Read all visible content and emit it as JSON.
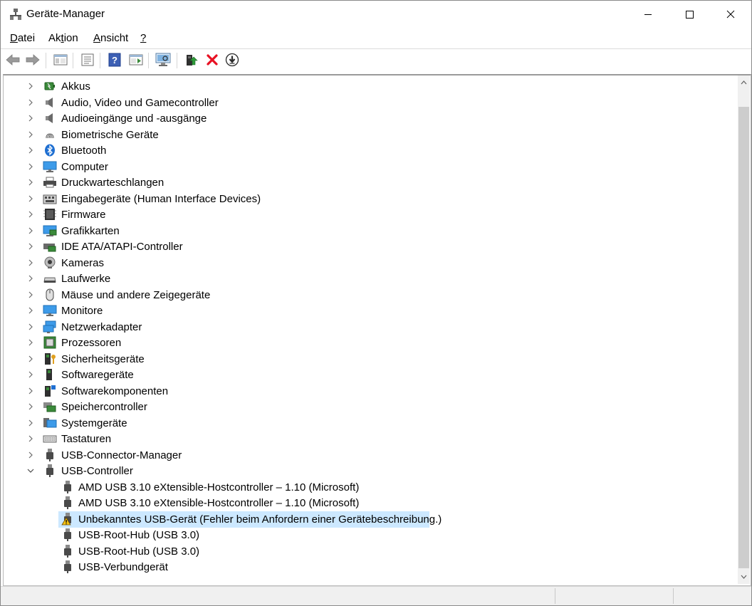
{
  "window": {
    "title": "Geräte-Manager"
  },
  "menu": [
    "Datei",
    "Aktion",
    "Ansicht",
    "?"
  ],
  "toolbar": {
    "buttons": [
      "back-icon",
      "forward-icon",
      "console-tree-icon",
      "properties-icon",
      "help-icon",
      "action-pane-icon",
      "scan-hardware-icon",
      "update-driver-icon",
      "uninstall-icon",
      "disable-device-icon"
    ]
  },
  "tree": {
    "categories": [
      {
        "label": "Akkus",
        "icon": "battery-icon"
      },
      {
        "label": "Audio, Video und Gamecontroller",
        "icon": "speaker-icon"
      },
      {
        "label": "Audioeingänge und -ausgänge",
        "icon": "speaker-icon"
      },
      {
        "label": "Biometrische Geräte",
        "icon": "fingerprint-icon"
      },
      {
        "label": "Bluetooth",
        "icon": "bluetooth-icon"
      },
      {
        "label": "Computer",
        "icon": "computer-icon"
      },
      {
        "label": "Druckwarteschlangen",
        "icon": "printer-icon"
      },
      {
        "label": "Eingabegeräte (Human Interface Devices)",
        "icon": "hid-icon"
      },
      {
        "label": "Firmware",
        "icon": "firmware-icon"
      },
      {
        "label": "Grafikkarten",
        "icon": "display-adapter-icon"
      },
      {
        "label": "IDE ATA/ATAPI-Controller",
        "icon": "ide-controller-icon"
      },
      {
        "label": "Kameras",
        "icon": "camera-icon"
      },
      {
        "label": "Laufwerke",
        "icon": "drive-icon"
      },
      {
        "label": "Mäuse und andere Zeigegeräte",
        "icon": "mouse-icon"
      },
      {
        "label": "Monitore",
        "icon": "monitor-icon"
      },
      {
        "label": "Netzwerkadapter",
        "icon": "network-adapter-icon"
      },
      {
        "label": "Prozessoren",
        "icon": "processor-icon"
      },
      {
        "label": "Sicherheitsgeräte",
        "icon": "security-device-icon"
      },
      {
        "label": "Softwaregeräte",
        "icon": "software-device-icon"
      },
      {
        "label": "Softwarekomponenten",
        "icon": "software-component-icon"
      },
      {
        "label": "Speichercontroller",
        "icon": "storage-controller-icon"
      },
      {
        "label": "Systemgeräte",
        "icon": "system-device-icon"
      },
      {
        "label": "Tastaturen",
        "icon": "keyboard-icon"
      },
      {
        "label": "USB-Connector-Manager",
        "icon": "usb-icon"
      },
      {
        "label": "USB-Controller",
        "icon": "usb-icon",
        "expanded": true
      }
    ],
    "usb_children": [
      {
        "label": "AMD USB 3.10 eXtensible-Hostcontroller – 1.10 (Microsoft)",
        "icon": "usb-icon"
      },
      {
        "label": "AMD USB 3.10 eXtensible-Hostcontroller – 1.10 (Microsoft)",
        "icon": "usb-icon"
      },
      {
        "label": "Unbekanntes USB-Gerät (Fehler beim Anfordern einer Gerätebeschreibung.)",
        "icon": "usb-warning-icon",
        "selected": true
      },
      {
        "label": "USB-Root-Hub (USB 3.0)",
        "icon": "usb-icon"
      },
      {
        "label": "USB-Root-Hub (USB 3.0)",
        "icon": "usb-icon"
      },
      {
        "label": "USB-Verbundgerät",
        "icon": "usb-icon"
      }
    ]
  },
  "colors": {
    "selection": "#cce8ff",
    "uninstall_red": "#e81123"
  }
}
